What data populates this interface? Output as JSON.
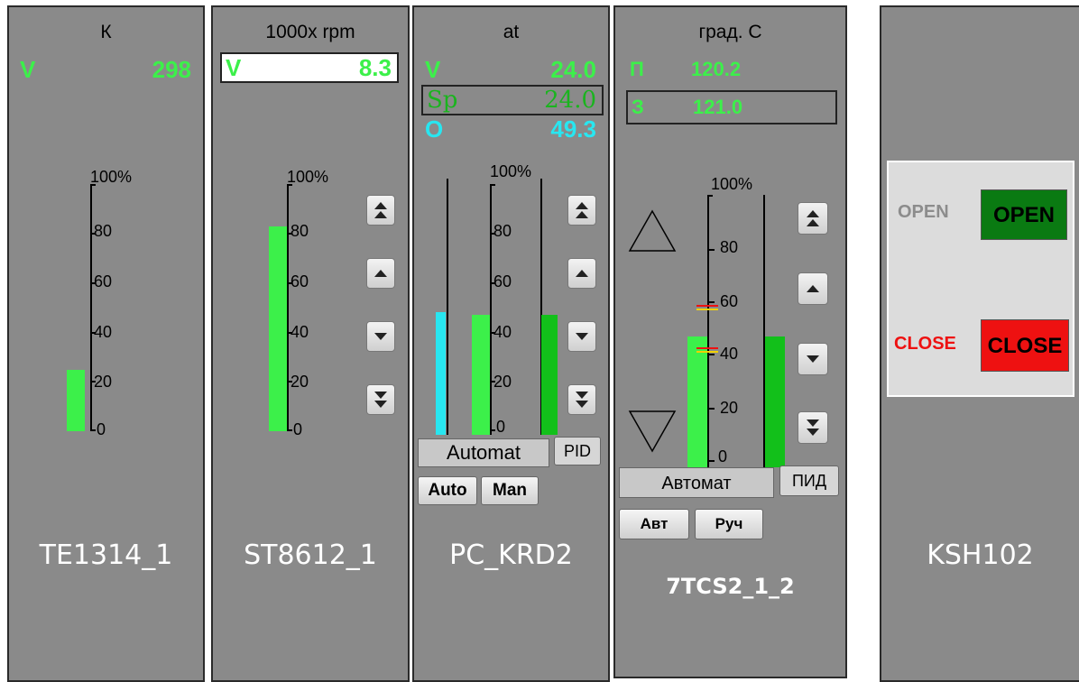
{
  "colors": {
    "panel": "#8a8a8a",
    "value_green": "#3cf04a",
    "value_cyan": "#28e6f0",
    "bar_green": "#3cf04a",
    "bar_dark_green": "#12c01a",
    "bar_cyan": "#28e6f0",
    "open_button": "#0a7a12",
    "close_button": "#ee1111"
  },
  "te1314": {
    "unit": "К",
    "v_label": "V",
    "v_value": "298",
    "scale_top": "100%",
    "ticks": [
      "80",
      "60",
      "40",
      "20",
      "0"
    ],
    "bar_percent": 25,
    "tag": "TE1314_1"
  },
  "st8612": {
    "unit": "1000x rpm",
    "v_label": "V",
    "v_value": "8.3",
    "scale_top": "100%",
    "ticks": [
      "80",
      "60",
      "40",
      "20",
      "0"
    ],
    "bar_percent": 83,
    "buttons": [
      "fast-up-icon",
      "step-up-icon",
      "step-down-icon",
      "fast-down-icon"
    ],
    "tag": "ST8612_1"
  },
  "pc_krd2": {
    "unit": "at",
    "v_label": "V",
    "v_value": "24.0",
    "sp_label": "Sp",
    "sp_value": "24.0",
    "o_label": "O",
    "o_value": "49.3",
    "scale_top": "100%",
    "ticks": [
      "80",
      "60",
      "40",
      "20",
      "0"
    ],
    "bar_output_percent": 49,
    "bar_value_percent": 48,
    "bar_setpoint_percent": 48,
    "mode_display": "Automat",
    "pid_button": "PID",
    "auto_button": "Auto",
    "man_button": "Man",
    "tag": "PC_KRD2"
  },
  "tcs2": {
    "unit": "град. С",
    "p_label": "П",
    "p_value": "120.2",
    "z_label": "З",
    "z_value": "121.0",
    "scale_top": "100%",
    "ticks": [
      "80",
      "60",
      "40",
      "20",
      "0"
    ],
    "bar_value_percent": 48,
    "bar_setpoint_percent": 48,
    "mode_display": "Автомат",
    "pid_button": "ПИД",
    "auto_button": "Авт",
    "man_button": "Руч",
    "tag": "7TCS2_1_2"
  },
  "ksh102": {
    "open_status": "OPEN",
    "open_button": "OPEN",
    "close_status": "CLOSE",
    "close_button": "CLOSE",
    "tag": "KSH102"
  }
}
